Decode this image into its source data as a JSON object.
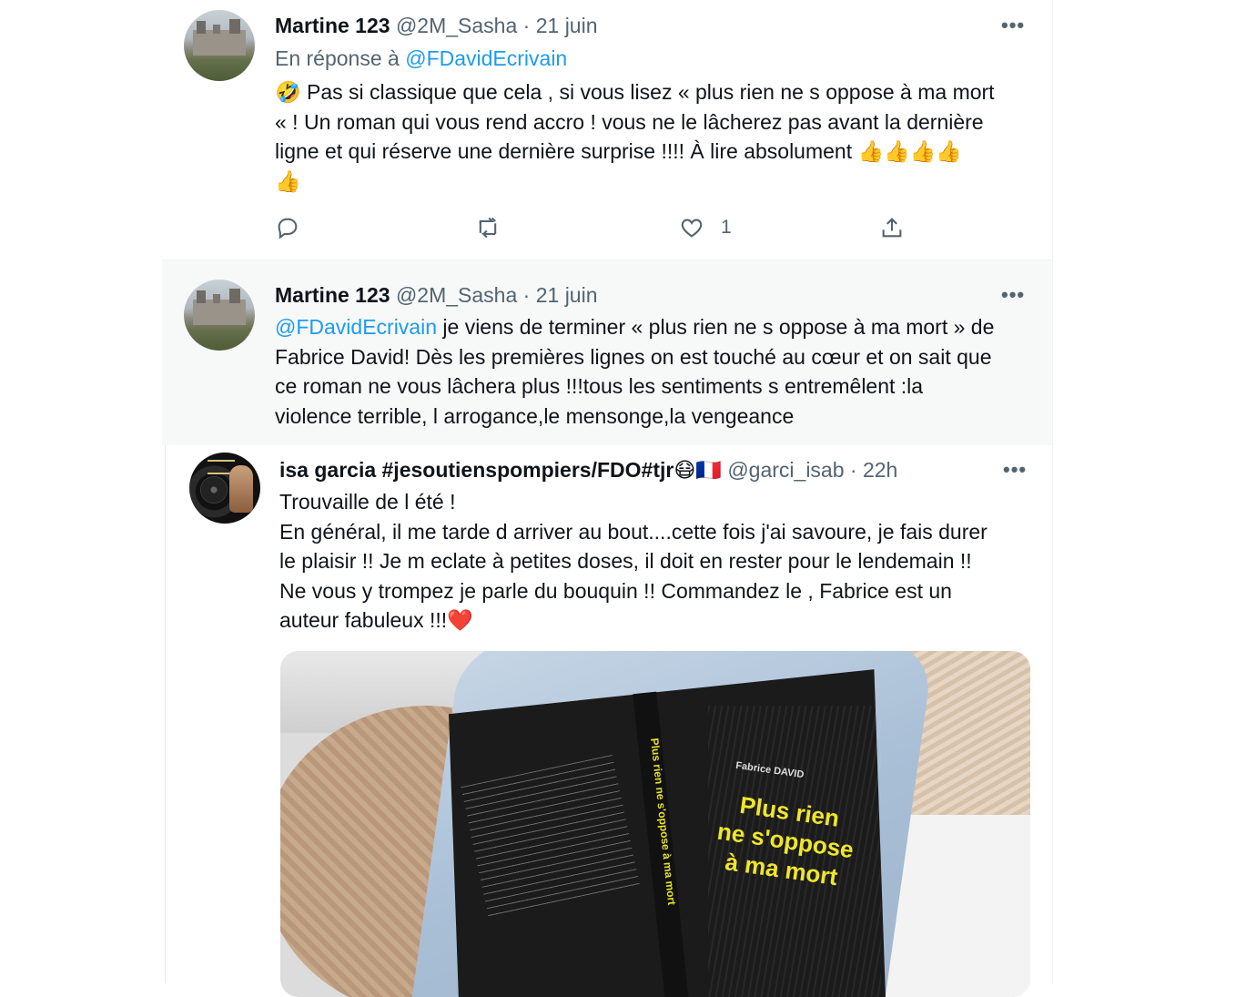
{
  "tweets": [
    {
      "author_name": "Martine 123",
      "handle": "@2M_Sasha",
      "dot": "·",
      "time": "21 juin",
      "more": "•••",
      "replying_prefix": "En réponse à ",
      "replying_handle": "@FDavidEcrivain",
      "body_lines": [
        "🤣 Pas si classique que cela , si vous  lisez « plus rien ne s oppose à ma mort",
        "«  ! Un roman qui vous rend accro ! vous ne le lâcherez pas avant la dernière",
        "ligne et qui réserve une dernière surprise !!!! À lire absolument 👍👍👍👍",
        "👍"
      ],
      "actions": {
        "reply_icon": "reply-icon",
        "retweet_icon": "retweet-icon",
        "like_icon": "heart-icon",
        "like_count": "1",
        "share_icon": "share-icon"
      }
    },
    {
      "author_name": "Martine 123",
      "handle": "@2M_Sasha",
      "dot": "·",
      "time": "21 juin",
      "more": "•••",
      "mention": "@FDavidEcrivain",
      "body_first_rest": " je viens de terminer « plus rien ne s oppose à ma mort » de",
      "body_lines": [
        "Fabrice David! Dès les premières lignes on est touché au cœur et on sait que",
        "ce roman ne vous  lâchera plus !!!tous les sentiments s entremêlent :la",
        "violence terrible, l arrogance,le mensonge,la vengeance"
      ]
    },
    {
      "author_name": "isa garcia #jesoutienspompiers/FDO#tjr😷🇫🇷",
      "handle": "@garci_isab",
      "dot": "·",
      "time": "22h",
      "more": "•••",
      "body_lines": [
        "Trouvaille de l été !",
        "En général, il me tarde d arriver au bout....cette fois j'ai savoure, je fais durer",
        "le plaisir !! Je m eclate à petites doses, il doit en rester pour le lendemain !!",
        "Ne vous y trompez je parle du bouquin !! Commandez le , Fabrice est un",
        "auteur fabuleux !!!❤️"
      ],
      "photo": {
        "author": "Fabrice DAVID",
        "title_lines": [
          "Plus rien",
          "ne s'oppose",
          "à ma mort"
        ],
        "spine": "Plus rien ne s'oppose à ma mort"
      }
    }
  ],
  "colors": {
    "link": "#1d9bf0",
    "muted": "#536471",
    "text": "#0f1419",
    "hover_bg": "#f7f9f9"
  }
}
